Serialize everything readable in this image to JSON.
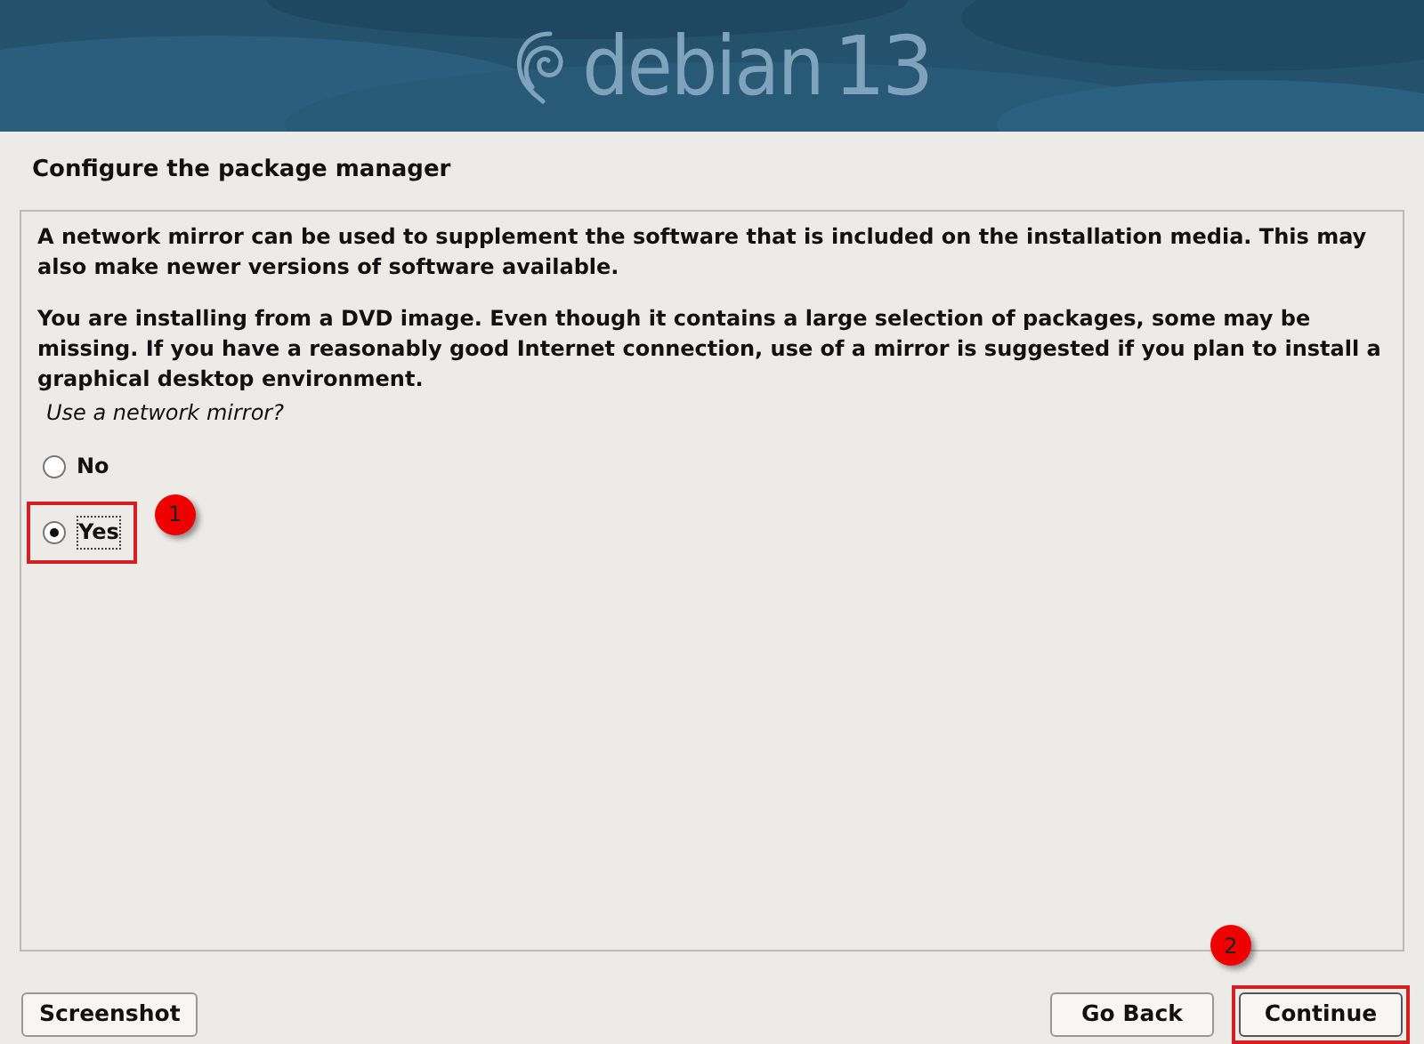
{
  "banner": {
    "logo_word": "debian",
    "logo_version": "13"
  },
  "title": "Configure the package manager",
  "paragraphs": [
    "A network mirror can be used to supplement the software that is included on the installation media. This may also make newer versions of software available.",
    "You are installing from a DVD image. Even though it contains a large selection of packages, some may be missing. If you have a reasonably good Internet connection, use of a mirror is suggested if you plan to install a graphical desktop environment."
  ],
  "question": "Use a network mirror?",
  "options": [
    {
      "label": "No",
      "selected": false
    },
    {
      "label": "Yes",
      "selected": true,
      "annotation": "1"
    }
  ],
  "buttons": {
    "screenshot": "Screenshot",
    "back": "Go Back",
    "continue": "Continue",
    "continue_annotation": "2"
  }
}
